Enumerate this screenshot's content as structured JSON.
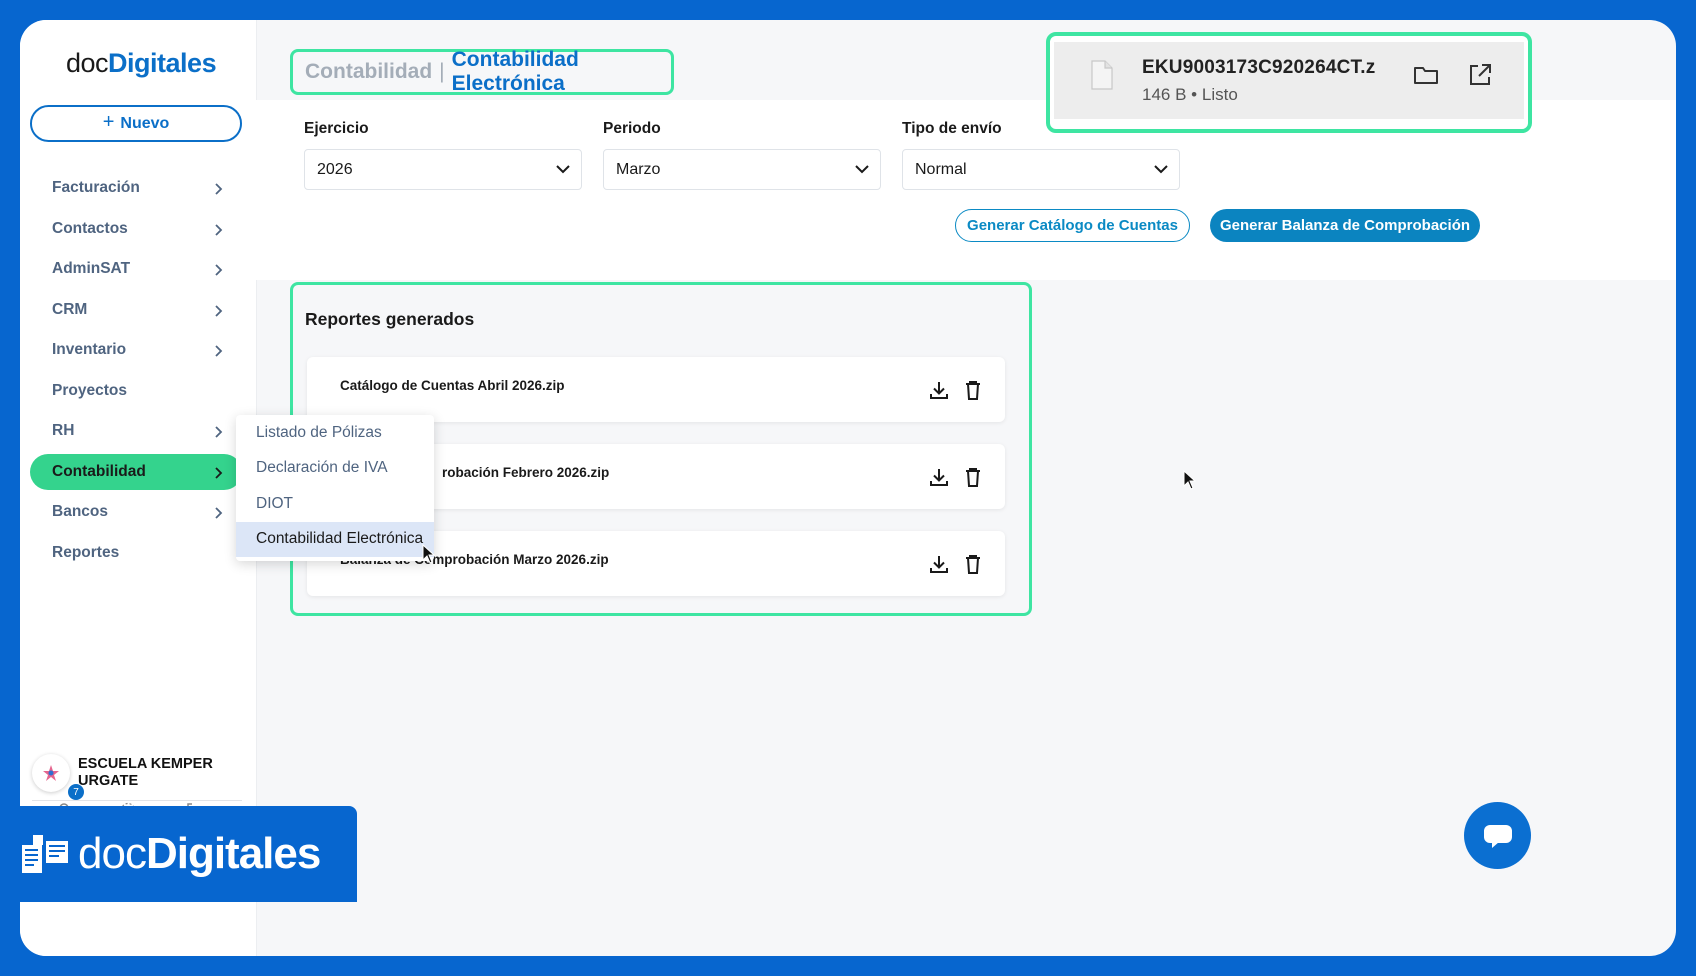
{
  "sidebar": {
    "logo_prefix": "doc",
    "logo_main": "Digitales",
    "new_button_label": "Nuevo",
    "items": [
      {
        "label": "Facturación",
        "has_chevron": true
      },
      {
        "label": "Contactos",
        "has_chevron": true
      },
      {
        "label": "AdminSAT",
        "has_chevron": true
      },
      {
        "label": "CRM",
        "has_chevron": true
      },
      {
        "label": "Inventario",
        "has_chevron": true
      },
      {
        "label": "Proyectos",
        "has_chevron": false
      },
      {
        "label": "RH",
        "has_chevron": true
      },
      {
        "label": "Contabilidad",
        "has_chevron": true,
        "active": true
      },
      {
        "label": "Bancos",
        "has_chevron": true
      },
      {
        "label": "Reportes",
        "has_chevron": false
      }
    ],
    "user": {
      "name_line1": "ESCUELA KEMPER",
      "name_line2": "URGATE"
    },
    "notification_count": "7"
  },
  "submenu": {
    "items": [
      {
        "label": "Listado de Pólizas"
      },
      {
        "label": "Declaración de IVA"
      },
      {
        "label": "DIOT"
      },
      {
        "label": "Contabilidad Electrónica",
        "active": true
      }
    ]
  },
  "header": {
    "breadcrumb_parent": "Contabilidad",
    "breadcrumb_separator": "|",
    "breadcrumb_current": "Contabilidad Electrónica"
  },
  "filters": {
    "ejercicio": {
      "label": "Ejercicio",
      "value": "2026"
    },
    "periodo": {
      "label": "Periodo",
      "value": "Marzo"
    },
    "tipo_envio": {
      "label": "Tipo de envío",
      "value": "Normal"
    }
  },
  "actions": {
    "catalog_button": "Generar Catálogo de Cuentas",
    "balance_button": "Generar Balanza de Comprobación"
  },
  "reports": {
    "title": "Reportes generados",
    "rows": [
      {
        "name": "Catálogo de Cuentas Abril 2026.zip"
      },
      {
        "name": "robación Febrero 2026.zip"
      },
      {
        "name": "Balanza de Comprobación Marzo 2026.zip"
      }
    ]
  },
  "download_popup": {
    "file_name": "EKU9003173C920264CT.z",
    "size": "146 B",
    "separator": "•",
    "status": "Listo"
  },
  "brand": {
    "prefix": "doc",
    "main": "Digitales"
  },
  "colors": {
    "frame": "#0766cf",
    "accent_green": "#34d38d",
    "highlight_border": "#3ee5a2",
    "primary_blue": "#0b6fc8"
  }
}
